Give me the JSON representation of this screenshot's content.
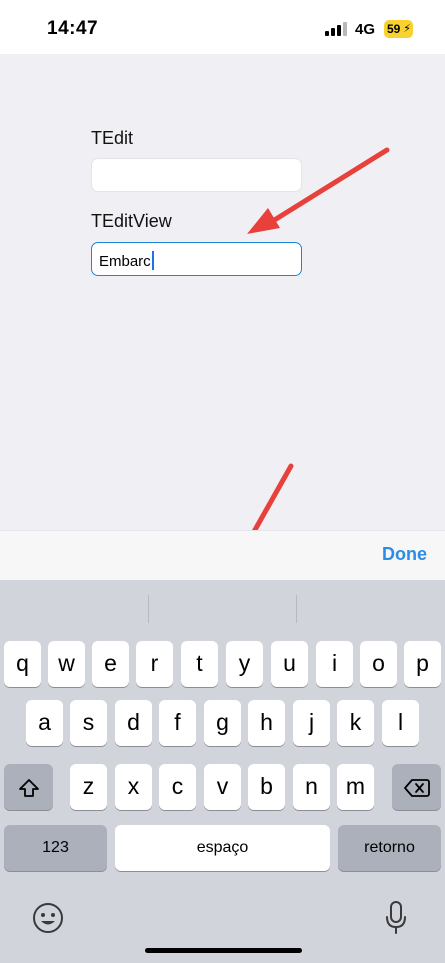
{
  "status_bar": {
    "time": "14:47",
    "network": "4G",
    "battery": "59",
    "icons": [
      "signal-icon",
      "battery-icon"
    ]
  },
  "form": {
    "tedit_label": "TEdit",
    "tedit_value": "",
    "teditview_label": "TEditView",
    "teditview_value": "Embarc"
  },
  "accessory_bar": {
    "done_label": "Done"
  },
  "keyboard": {
    "row1": [
      "q",
      "w",
      "e",
      "r",
      "t",
      "y",
      "u",
      "i",
      "o",
      "p"
    ],
    "row2": [
      "a",
      "s",
      "d",
      "f",
      "g",
      "h",
      "j",
      "k",
      "l"
    ],
    "row3": [
      "z",
      "x",
      "c",
      "v",
      "b",
      "n",
      "m"
    ],
    "numbers_label": "123",
    "space_label": "espaço",
    "return_label": "retorno",
    "icons": [
      "shift-icon",
      "backspace-icon",
      "emoji-icon",
      "microphone-icon"
    ]
  },
  "colors": {
    "accent": "#2b8de6",
    "focus_border": "#1b88d6",
    "arrow": "#e8403a",
    "battery": "#f7d230",
    "keyboard_bg": "#d2d4db"
  }
}
